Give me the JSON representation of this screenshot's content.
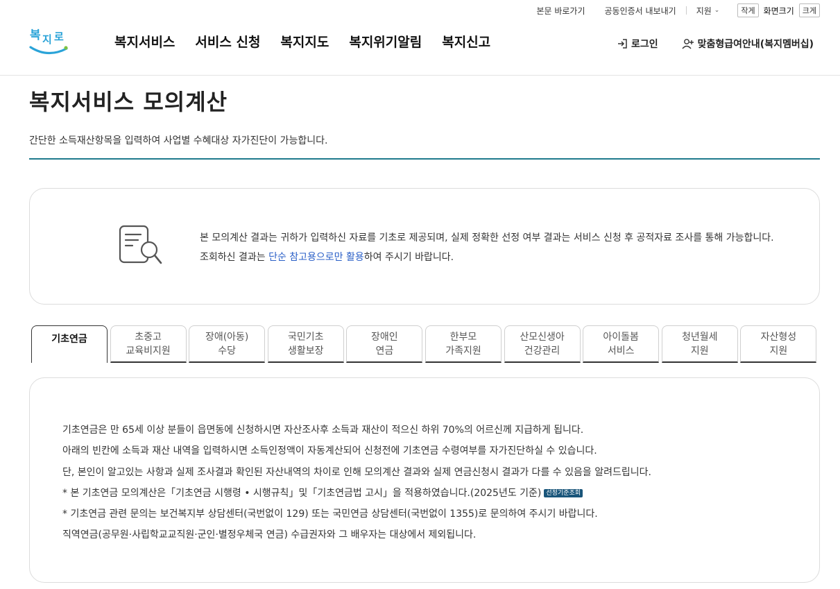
{
  "utility": {
    "skip_link": "본문 바로가기",
    "cert_export": "공동인증서 내보내기",
    "lang": "지원",
    "font_small": "작게",
    "font_label": "화면크기",
    "font_large": "크게"
  },
  "header": {
    "logo_text": "복지로",
    "nav": [
      "복지서비스",
      "서비스 신청",
      "복지지도",
      "복지위기알림",
      "복지신고"
    ],
    "login": "로그인",
    "membership": "맞춤형급여안내(복지멤버십)"
  },
  "page": {
    "title": "복지서비스 모의계산",
    "description": "간단한 소득재산항목을 입력하여 사업별 수혜대상 자가진단이 가능합니다."
  },
  "notice": {
    "text_before": "본 모의계산 결과는 귀하가 입력하신 자료를 기초로 제공되며, 실제 정확한 선정 여부 결과는 서비스 신청 후 공적자료 조사를 통해 가능합니다. 조회하신 결과는 ",
    "highlight": "단순 참고용으로만 활용",
    "text_after": "하여 주시기 바랍니다."
  },
  "tabs": [
    {
      "label": "기초연금",
      "active": true
    },
    {
      "label": "초중고\n교육비지원",
      "active": false
    },
    {
      "label": "장애(아동)\n수당",
      "active": false
    },
    {
      "label": "국민기초\n생활보장",
      "active": false
    },
    {
      "label": "장애인\n연금",
      "active": false
    },
    {
      "label": "한부모\n가족지원",
      "active": false
    },
    {
      "label": "산모신생아\n건강관리",
      "active": false
    },
    {
      "label": "아이돌봄\n서비스",
      "active": false
    },
    {
      "label": "청년월세\n지원",
      "active": false
    },
    {
      "label": "자산형성\n지원",
      "active": false
    }
  ],
  "info": {
    "line1": "기초연금은 만 65세 이상 분들이 읍면동에 신청하시면 자산조사후 소득과 재산이 적으신 하위 70%의 어르신께 지급하게 됩니다.",
    "line2": "아래의 빈칸에 소득과 재산 내역을 입력하시면 소득인정액이 자동계산되어 신청전에 기초연금 수령여부를 자가진단하실 수 있습니다.",
    "line3": "단, 본인이 알고있는 사항과 실제 조사결과 확인된 자산내역의 차이로 인해 모의계산 결과와 실제 연금신청시 결과가 다를 수 있음을 알려드립니다.",
    "line4": "* 본 기초연금 모의계산은「기초연금 시행령 • 시행규칙」및「기초연금법 고시」을 적용하였습니다.(2025년도 기준)",
    "badge": "선정기준조회",
    "line5": "* 기초연금 관련 문의는 보건복지부 상담센터(국번없이 129) 또는 국민연금 상담센터(국번없이 1355)로 문의하여 주시기 바랍니다.",
    "line6": "직역연금(공무원·사립학교교직원·군인·별정우체국 연금) 수급권자와 그 배우자는 대상에서 제외됩니다."
  },
  "colors": {
    "accent": "#1f7a8c",
    "link": "#2a5fc7",
    "badge": "#19557a",
    "logo_blue": "#2aa3d8",
    "logo_green": "#7cc242"
  }
}
